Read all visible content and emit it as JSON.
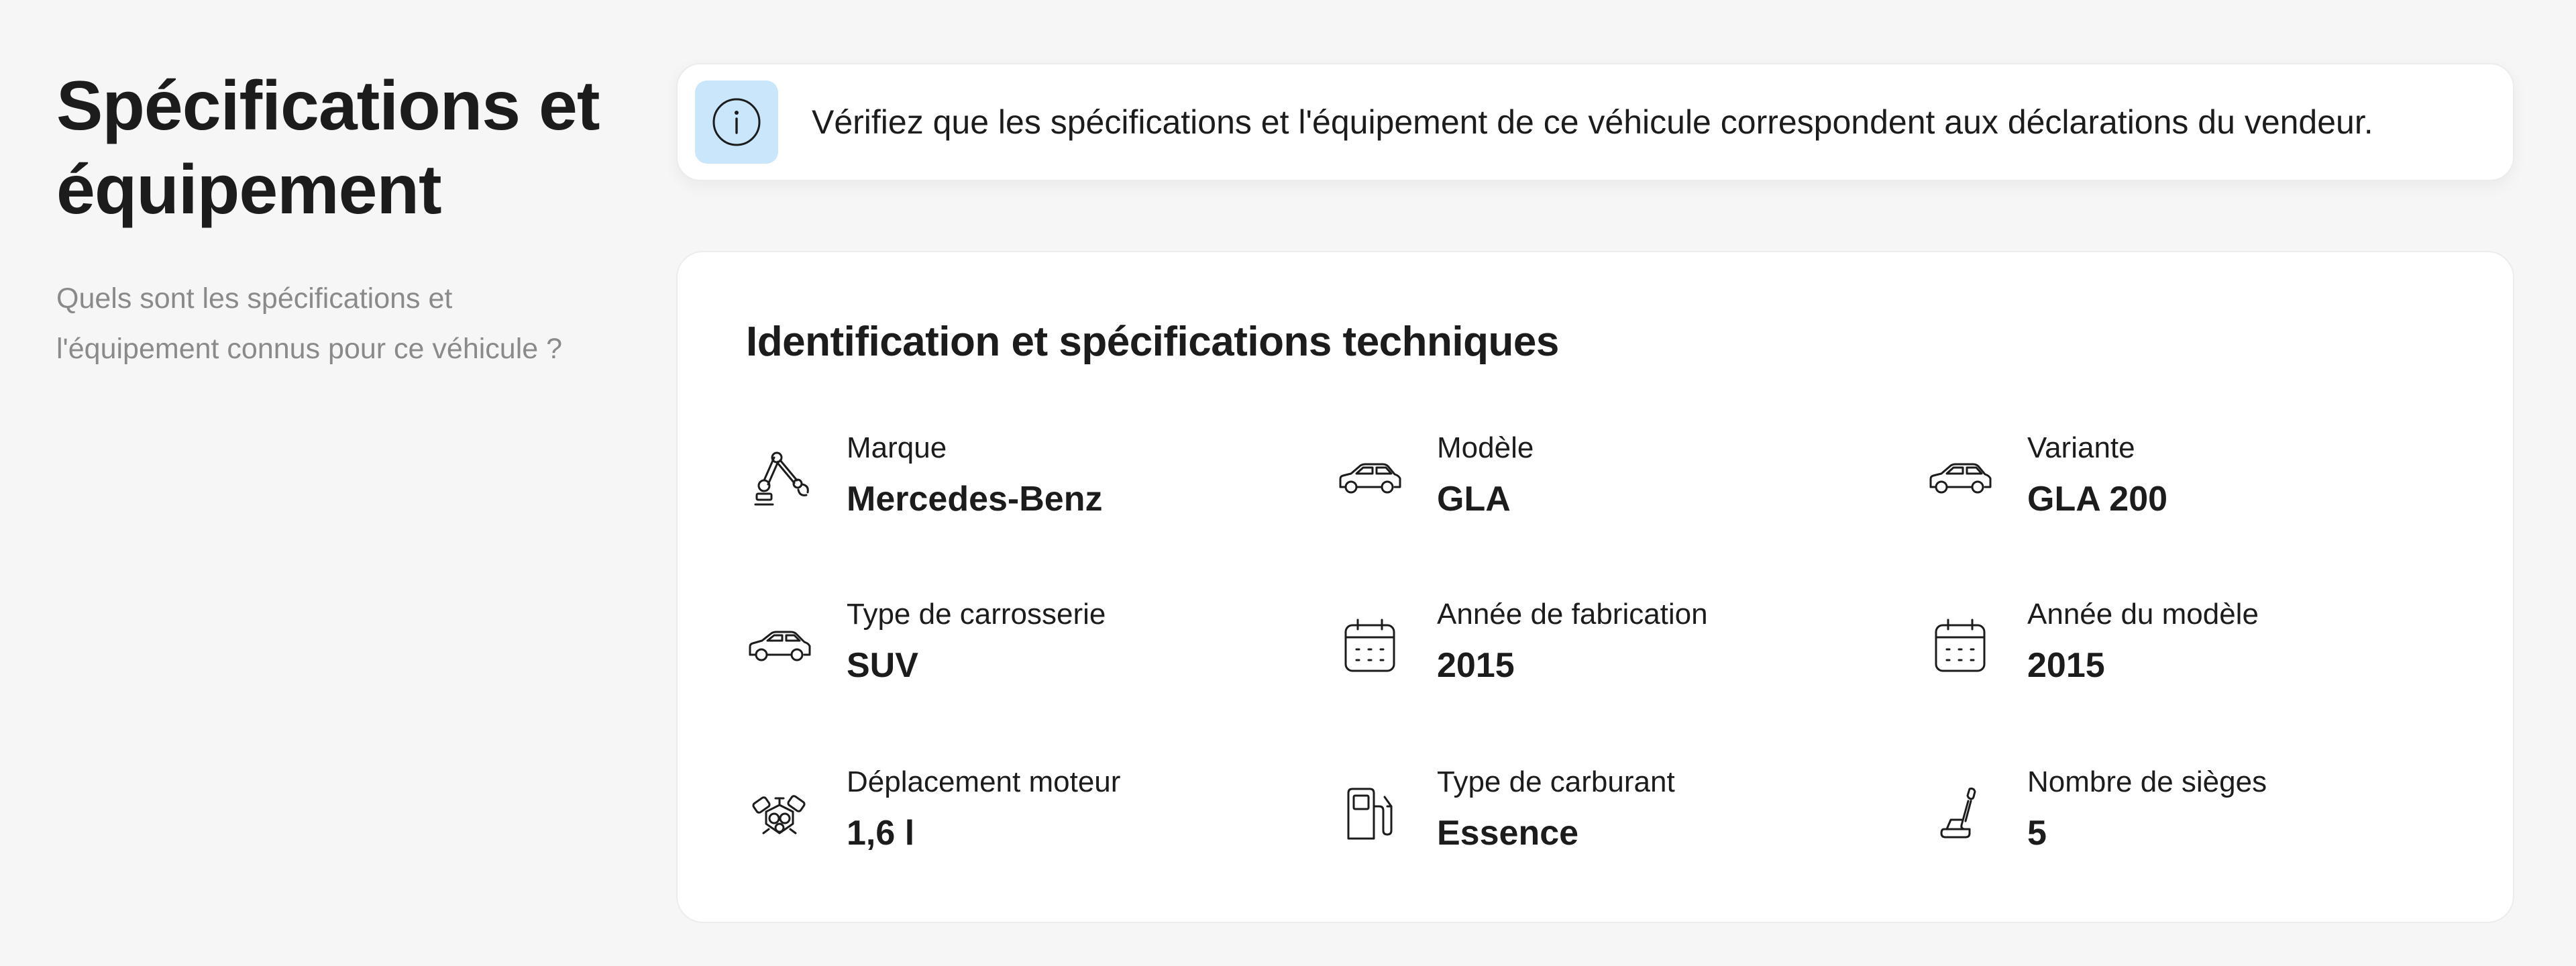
{
  "header": {
    "title": "Spécifications et équipement",
    "subtitle": "Quels sont les spécifications et l'équipement connus pour ce véhicule ?"
  },
  "banner": {
    "icon": "info-icon",
    "text": "Vérifiez que les spécifications et l'équipement de ce véhicule correspondent aux déclarations du vendeur.",
    "icon_bg": "#c9e6fb"
  },
  "card": {
    "title": "Identification et spécifications techniques",
    "specs": [
      {
        "icon": "robot-arm-icon",
        "label": "Marque",
        "value": "Mercedes-Benz"
      },
      {
        "icon": "car-icon",
        "label": "Modèle",
        "value": "GLA"
      },
      {
        "icon": "car-icon",
        "label": "Variante",
        "value": "GLA 200"
      },
      {
        "icon": "car-icon",
        "label": "Type de carrosserie",
        "value": "SUV"
      },
      {
        "icon": "calendar-icon",
        "label": "Année de fabrication",
        "value": "2015"
      },
      {
        "icon": "calendar-icon",
        "label": "Année du modèle",
        "value": "2015"
      },
      {
        "icon": "engine-icon",
        "label": "Déplacement moteur",
        "value": "1,6 l"
      },
      {
        "icon": "fuel-pump-icon",
        "label": "Type de carburant",
        "value": "Essence"
      },
      {
        "icon": "seat-icon",
        "label": "Nombre de sièges",
        "value": "5"
      }
    ]
  }
}
